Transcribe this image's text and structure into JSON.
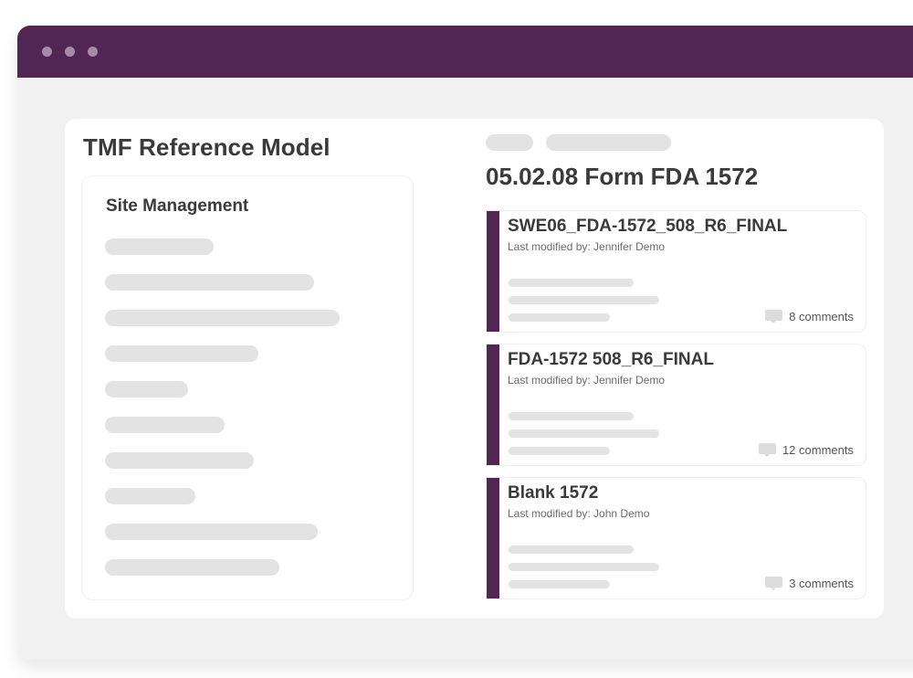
{
  "model": {
    "title": "TMF Reference Model",
    "section_title": "Site Management"
  },
  "document_group": {
    "title": "05.02.08 Form FDA 1572"
  },
  "documents": [
    {
      "name": "SWE06_FDA-1572_508_R6_FINAL",
      "modified": "Last modified by: Jennifer Demo",
      "comments": "8 comments",
      "comment_icon": "comment-icon"
    },
    {
      "name": "FDA-1572 508_R6_FINAL",
      "modified": "Last modified by: Jennifer Demo",
      "comments": "12 comments",
      "comment_icon": "comment-icon"
    },
    {
      "name": "Blank 1572",
      "modified": "Last modified by: John Demo",
      "comments": "3 comments",
      "comment_icon": "comment-icon"
    }
  ],
  "colors": {
    "brand": "#522653",
    "window_background": "#f1f1f1",
    "placeholder": "#e3e3e3"
  }
}
